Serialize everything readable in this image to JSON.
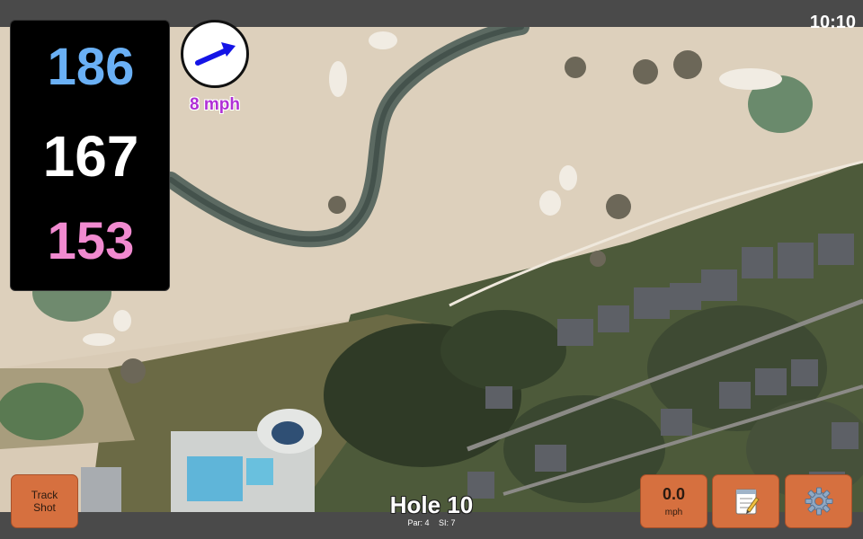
{
  "status": {
    "time": "10:10"
  },
  "distances": {
    "back": "186",
    "center": "167",
    "front": "153"
  },
  "wind": {
    "speed": "8 mph",
    "direction_icon": "arrow-right-up-icon"
  },
  "hole": {
    "title": "Hole 10",
    "par": "Par: 4",
    "si": "SI: 7"
  },
  "buttons": {
    "track_shot_line1": "Track",
    "track_shot_line2": "Shot",
    "speed_value": "0.0",
    "speed_unit": "mph",
    "notes_icon": "notepad-icon",
    "settings_icon": "gear-icon"
  },
  "colors": {
    "back": "#6ab0f5",
    "center": "#ffffff",
    "front": "#f18ad0",
    "wind_text": "#b02fd6",
    "button": "#d6703f"
  }
}
